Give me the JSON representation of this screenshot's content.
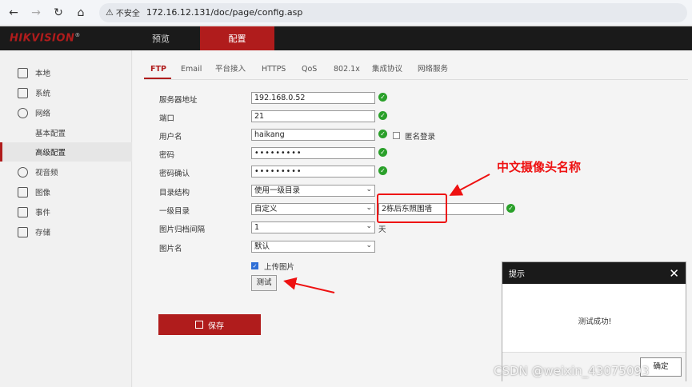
{
  "browser": {
    "security_label": "不安全",
    "url": "172.16.12.131/doc/page/config.asp"
  },
  "header": {
    "logo": "HIKVISION",
    "tabs": [
      {
        "label": "预览",
        "active": false
      },
      {
        "label": "配置",
        "active": true
      }
    ]
  },
  "sidebar": {
    "items": [
      {
        "label": "本地",
        "icon": "monitor-icon"
      },
      {
        "label": "系统",
        "icon": "system-icon"
      },
      {
        "label": "网络",
        "icon": "globe-icon"
      },
      {
        "label": "基本配置",
        "sub": true
      },
      {
        "label": "高级配置",
        "sub": true,
        "active": true
      },
      {
        "label": "视音频",
        "icon": "video-icon"
      },
      {
        "label": "图像",
        "icon": "image-icon"
      },
      {
        "label": "事件",
        "icon": "calendar-icon"
      },
      {
        "label": "存储",
        "icon": "storage-icon"
      }
    ]
  },
  "tabs": [
    "FTP",
    "Email",
    "平台接入",
    "HTTPS",
    "QoS",
    "802.1x",
    "集成协议",
    "网络服务"
  ],
  "form": {
    "server_label": "服务器地址",
    "server_value": "192.168.0.52",
    "port_label": "端口",
    "port_value": "21",
    "user_label": "用户名",
    "user_value": "haikang",
    "anon_label": "匿名登录",
    "pwd_label": "密码",
    "pwd_value": "•••••••••",
    "pwd_confirm_label": "密码确认",
    "pwd_confirm_value": "•••••••••",
    "dir_label": "目录结构",
    "dir_value": "使用一级目录",
    "level1_label": "一级目录",
    "level1_value": "自定义",
    "level1_custom": "2栋后东照围墙",
    "interval_label": "图片归档间隔",
    "interval_value": "1",
    "interval_unit": "天",
    "picname_label": "图片名",
    "picname_value": "默认",
    "upload_label": "上传图片",
    "test_label": "测试",
    "save_label": "保存"
  },
  "annotation": {
    "text": "中文摄像头名称",
    "color": "#ee1111"
  },
  "dialog": {
    "title": "提示",
    "message": "测试成功!",
    "ok_label": "确定"
  },
  "watermark": "CSDN @weixin_43075093",
  "colors": {
    "brand_red": "#b01c1c",
    "ok_green": "#2aa02a"
  }
}
